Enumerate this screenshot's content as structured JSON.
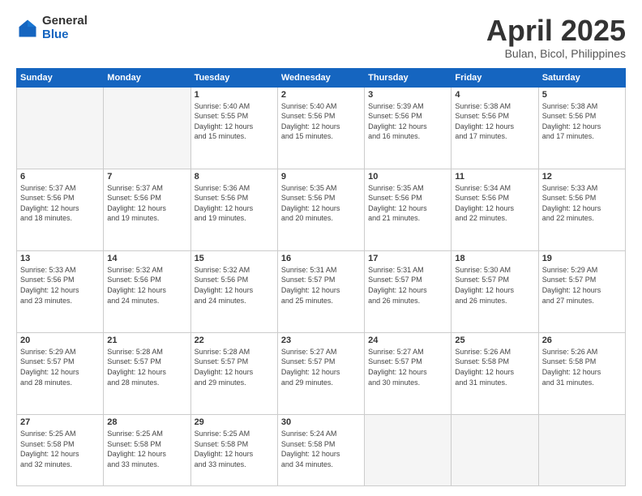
{
  "logo": {
    "general": "General",
    "blue": "Blue"
  },
  "title": {
    "month": "April 2025",
    "location": "Bulan, Bicol, Philippines"
  },
  "weekdays": [
    "Sunday",
    "Monday",
    "Tuesday",
    "Wednesday",
    "Thursday",
    "Friday",
    "Saturday"
  ],
  "weeks": [
    [
      {
        "day": "",
        "info": ""
      },
      {
        "day": "",
        "info": ""
      },
      {
        "day": "1",
        "info": "Sunrise: 5:40 AM\nSunset: 5:55 PM\nDaylight: 12 hours\nand 15 minutes."
      },
      {
        "day": "2",
        "info": "Sunrise: 5:40 AM\nSunset: 5:56 PM\nDaylight: 12 hours\nand 15 minutes."
      },
      {
        "day": "3",
        "info": "Sunrise: 5:39 AM\nSunset: 5:56 PM\nDaylight: 12 hours\nand 16 minutes."
      },
      {
        "day": "4",
        "info": "Sunrise: 5:38 AM\nSunset: 5:56 PM\nDaylight: 12 hours\nand 17 minutes."
      },
      {
        "day": "5",
        "info": "Sunrise: 5:38 AM\nSunset: 5:56 PM\nDaylight: 12 hours\nand 17 minutes."
      }
    ],
    [
      {
        "day": "6",
        "info": "Sunrise: 5:37 AM\nSunset: 5:56 PM\nDaylight: 12 hours\nand 18 minutes."
      },
      {
        "day": "7",
        "info": "Sunrise: 5:37 AM\nSunset: 5:56 PM\nDaylight: 12 hours\nand 19 minutes."
      },
      {
        "day": "8",
        "info": "Sunrise: 5:36 AM\nSunset: 5:56 PM\nDaylight: 12 hours\nand 19 minutes."
      },
      {
        "day": "9",
        "info": "Sunrise: 5:35 AM\nSunset: 5:56 PM\nDaylight: 12 hours\nand 20 minutes."
      },
      {
        "day": "10",
        "info": "Sunrise: 5:35 AM\nSunset: 5:56 PM\nDaylight: 12 hours\nand 21 minutes."
      },
      {
        "day": "11",
        "info": "Sunrise: 5:34 AM\nSunset: 5:56 PM\nDaylight: 12 hours\nand 22 minutes."
      },
      {
        "day": "12",
        "info": "Sunrise: 5:33 AM\nSunset: 5:56 PM\nDaylight: 12 hours\nand 22 minutes."
      }
    ],
    [
      {
        "day": "13",
        "info": "Sunrise: 5:33 AM\nSunset: 5:56 PM\nDaylight: 12 hours\nand 23 minutes."
      },
      {
        "day": "14",
        "info": "Sunrise: 5:32 AM\nSunset: 5:56 PM\nDaylight: 12 hours\nand 24 minutes."
      },
      {
        "day": "15",
        "info": "Sunrise: 5:32 AM\nSunset: 5:56 PM\nDaylight: 12 hours\nand 24 minutes."
      },
      {
        "day": "16",
        "info": "Sunrise: 5:31 AM\nSunset: 5:57 PM\nDaylight: 12 hours\nand 25 minutes."
      },
      {
        "day": "17",
        "info": "Sunrise: 5:31 AM\nSunset: 5:57 PM\nDaylight: 12 hours\nand 26 minutes."
      },
      {
        "day": "18",
        "info": "Sunrise: 5:30 AM\nSunset: 5:57 PM\nDaylight: 12 hours\nand 26 minutes."
      },
      {
        "day": "19",
        "info": "Sunrise: 5:29 AM\nSunset: 5:57 PM\nDaylight: 12 hours\nand 27 minutes."
      }
    ],
    [
      {
        "day": "20",
        "info": "Sunrise: 5:29 AM\nSunset: 5:57 PM\nDaylight: 12 hours\nand 28 minutes."
      },
      {
        "day": "21",
        "info": "Sunrise: 5:28 AM\nSunset: 5:57 PM\nDaylight: 12 hours\nand 28 minutes."
      },
      {
        "day": "22",
        "info": "Sunrise: 5:28 AM\nSunset: 5:57 PM\nDaylight: 12 hours\nand 29 minutes."
      },
      {
        "day": "23",
        "info": "Sunrise: 5:27 AM\nSunset: 5:57 PM\nDaylight: 12 hours\nand 29 minutes."
      },
      {
        "day": "24",
        "info": "Sunrise: 5:27 AM\nSunset: 5:57 PM\nDaylight: 12 hours\nand 30 minutes."
      },
      {
        "day": "25",
        "info": "Sunrise: 5:26 AM\nSunset: 5:58 PM\nDaylight: 12 hours\nand 31 minutes."
      },
      {
        "day": "26",
        "info": "Sunrise: 5:26 AM\nSunset: 5:58 PM\nDaylight: 12 hours\nand 31 minutes."
      }
    ],
    [
      {
        "day": "27",
        "info": "Sunrise: 5:25 AM\nSunset: 5:58 PM\nDaylight: 12 hours\nand 32 minutes."
      },
      {
        "day": "28",
        "info": "Sunrise: 5:25 AM\nSunset: 5:58 PM\nDaylight: 12 hours\nand 33 minutes."
      },
      {
        "day": "29",
        "info": "Sunrise: 5:25 AM\nSunset: 5:58 PM\nDaylight: 12 hours\nand 33 minutes."
      },
      {
        "day": "30",
        "info": "Sunrise: 5:24 AM\nSunset: 5:58 PM\nDaylight: 12 hours\nand 34 minutes."
      },
      {
        "day": "",
        "info": ""
      },
      {
        "day": "",
        "info": ""
      },
      {
        "day": "",
        "info": ""
      }
    ]
  ]
}
